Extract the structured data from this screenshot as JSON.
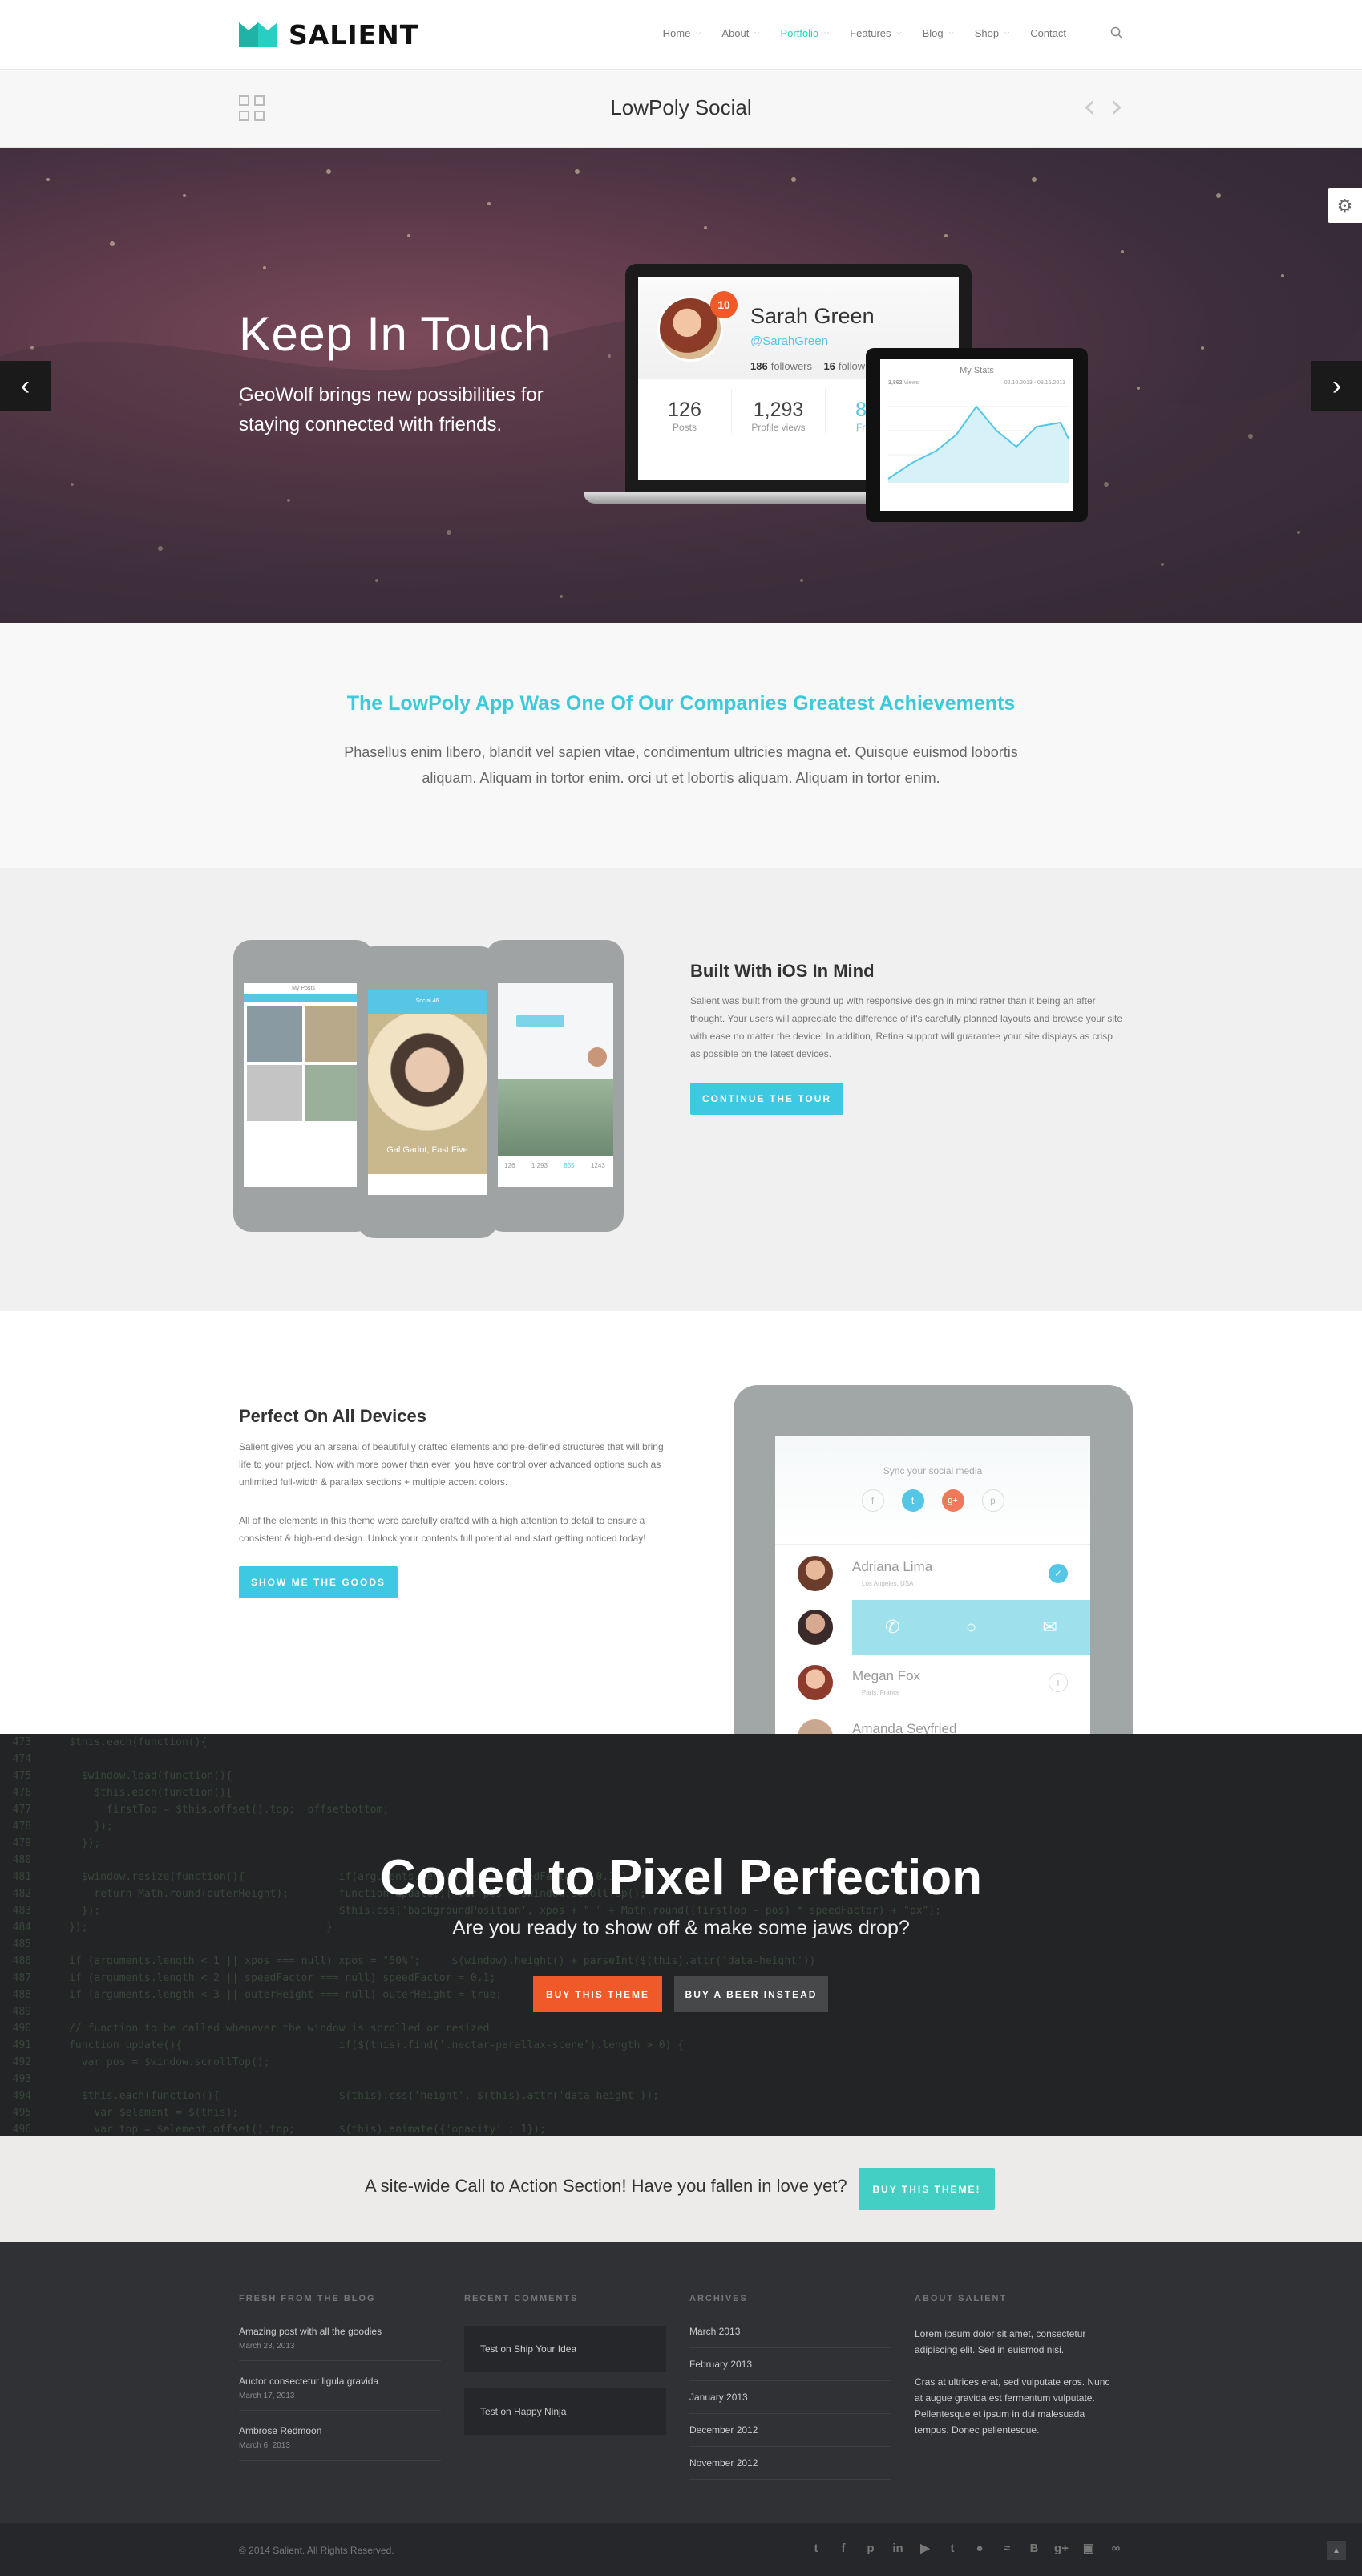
{
  "brand": {
    "name": "SALIENT",
    "accent": "#27cfc3",
    "orange": "#f05a28",
    "cyan": "#3dc9e2"
  },
  "nav": {
    "items": [
      {
        "label": "Home",
        "dropdown": true
      },
      {
        "label": "About",
        "dropdown": true
      },
      {
        "label": "Portfolio",
        "dropdown": true,
        "active": true
      },
      {
        "label": "Features",
        "dropdown": true
      },
      {
        "label": "Blog",
        "dropdown": true
      },
      {
        "label": "Shop",
        "dropdown": true
      },
      {
        "label": "Contact",
        "dropdown": false
      }
    ],
    "search_icon": "search-icon"
  },
  "project": {
    "title": "LowPoly Social"
  },
  "hero": {
    "title": "Keep In Touch",
    "subtitle": "GeoWolf brings new possibilities for staying connected with friends.",
    "profile": {
      "name": "Sarah Green",
      "handle": "@SarahGreen",
      "notifications": "10",
      "followers": "186",
      "followers_label": "followers",
      "following": "16",
      "following_label": "following",
      "posts": "126",
      "posts_label": "Posts",
      "views": "1,293",
      "views_label": "Profile views",
      "friends": "855",
      "friends_label": "Friends"
    },
    "stats": {
      "title": "My Stats",
      "views": "3,862",
      "views_label": "Views",
      "range": "02.10.2013 - 08.15.2013"
    }
  },
  "intro": {
    "heading": "The LowPoly App Was One Of Our Companies Greatest Achievements",
    "text": "Phasellus enim libero, blandit vel sapien vitae, condimentum ultricies magna et. Quisque euismod lobortis aliquam. Aliquam in tortor enim. orci ut et lobortis aliquam. Aliquam in tortor enim."
  },
  "ios": {
    "heading": "Built With iOS In Mind",
    "text": "Salient was built from the ground up with responsive design in mind rather than it being an after thought. Your users will appreciate the difference of it's carefully planned layouts and browse your site with ease no matter the device! In addition, Retina support will guarantee your site displays as crisp as possible on the latest devices.",
    "button": "CONTINUE THE TOUR",
    "phone_caption": "Gal Gadot, Fast Five",
    "phone_left_title": "My Posts",
    "phone_center_title": "Social 46",
    "phone_right_stats": [
      "126",
      "1,293",
      "855",
      "1243"
    ]
  },
  "devices": {
    "heading": "Perfect On All Devices",
    "text1": "Salient gives you an arsenal of beautifully crafted elements and pre-defined structures that will bring life to your prject. Now with more power than ever, you have control over advanced options such as unlimited full-width & parallax sections + multiple accent colors.",
    "text2": "All of the elements in this theme were carefully crafted with a high attention to detail to ensure a consistent & high-end design. Unlock your contents full potential and start getting noticed today!",
    "button": "SHOW ME THE GOODS",
    "ipad": {
      "sync_label": "Sync your social media",
      "contacts": [
        {
          "name": "Adriana Lima",
          "place": "Los Angeles, USA"
        },
        {
          "name": "Megan Fox",
          "place": "Paris, France"
        },
        {
          "name": "Amanda Seyfried",
          "place": ""
        }
      ]
    }
  },
  "coded": {
    "heading": "Coded to Pixel Perfection",
    "subtitle": "Are you ready to show off & make some jaws drop?",
    "btn_primary": "BUY THIS THEME",
    "btn_secondary": "BUY A BEER INSTEAD"
  },
  "cta": {
    "text": "A site-wide Call to Action Section! Have you fallen in love yet?",
    "button": "BUY THIS THEME!"
  },
  "footer": {
    "blog_heading": "FRESH FROM THE BLOG",
    "blog": [
      {
        "title": "Amazing post with all the goodies",
        "date": "March 23, 2013"
      },
      {
        "title": "Auctor consectetur ligula gravida",
        "date": "March 17, 2013"
      },
      {
        "title": "Ambrose Redmoon",
        "date": "March 6, 2013"
      }
    ],
    "comments_heading": "RECENT COMMENTS",
    "comments": [
      "Test on Ship Your Idea",
      "Test on Happy Ninja"
    ],
    "archives_heading": "ARCHIVES",
    "archives": [
      "March 2013",
      "February 2013",
      "January 2013",
      "December 2012",
      "November 2012"
    ],
    "about_heading": "ABOUT SALIENT",
    "about1": "Lorem ipsum dolor sit amet, consectetur adipiscing elit. Sed in euismod nisi.",
    "about2": "Cras at ultrices erat, sed vulputate eros. Nunc at augue gravida est fermentum vulputate. Pellentesque et ipsum in dui malesuada tempus. Donec pellentesque.",
    "copyright": "© 2014 Salient. All Rights Reserved.",
    "social_icons": [
      "twitter-icon",
      "facebook-icon",
      "pinterest-icon",
      "linkedin-icon",
      "youtube-icon",
      "tumblr-icon",
      "dribbble-icon",
      "rss-icon",
      "behance-icon",
      "google-plus-icon",
      "instagram-icon",
      "stumbleupon-icon"
    ]
  }
}
